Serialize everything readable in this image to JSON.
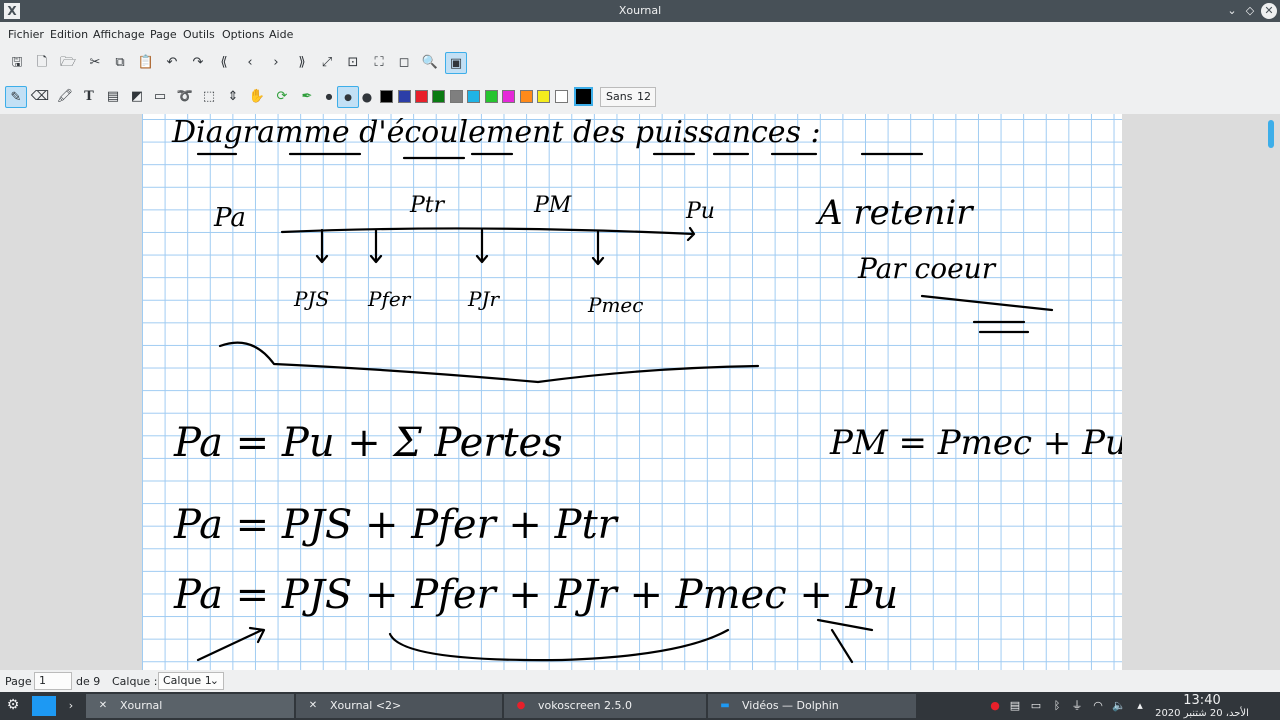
{
  "window": {
    "title": "Xournal",
    "app_icon": "X",
    "controls": {
      "minimize": "⌄",
      "maximize": "◇",
      "close": "✕"
    }
  },
  "menu": [
    "Fichier",
    "Edition",
    "Affichage",
    "Page",
    "Outils",
    "Options",
    "Aide"
  ],
  "toolbar_main": [
    "save-icon",
    "new-icon",
    "open-icon",
    "cut-icon",
    "copy-icon",
    "paste-icon",
    "undo-icon",
    "redo-icon",
    "first-page-icon",
    "prev-page-icon",
    "next-page-icon",
    "last-page-icon",
    "zoom-fit-icon",
    "zoom-page-icon",
    "zoom-full-icon",
    "search-icon",
    "fullscreen-icon"
  ],
  "toolbar_tools": {
    "tools": [
      "pen-icon",
      "eraser-icon",
      "highlighter-icon",
      "text-icon",
      "image-icon",
      "shape-icon",
      "ruler-icon",
      "lasso-icon",
      "rect-select-icon",
      "vspace-icon",
      "hand-icon",
      "default-tool-icon",
      "default-pen-icon"
    ],
    "colors": [
      "#000000",
      "#2c3ea8",
      "#e8202a",
      "#0a7a12",
      "#7f7f7f",
      "#1fb4e6",
      "#26c42f",
      "#e528d9",
      "#ff8a1a",
      "#f4ec1d",
      "#ffffff"
    ],
    "selected_color": "#000000",
    "font_name": "Sans",
    "font_size": "12"
  },
  "status": {
    "page_label": "Page",
    "page_value": "1",
    "page_total": "de 9",
    "layer_label": "Calque :",
    "layer_value": "Calque 1"
  },
  "note": {
    "heading": "Diagramme d'écoulement des puissances :",
    "flow_labels": [
      "Pa",
      "Ptr",
      "PM",
      "Pu"
    ],
    "loss_labels": [
      "PJS",
      "Pfer",
      "PJr",
      "Pmec"
    ],
    "aside": [
      "A retenir",
      "Par coeur"
    ],
    "equations": [
      "Pa = Pu + Σ Pertes",
      "PM = Pmec + Pu",
      "Pa = PJS + Pfer + Ptr",
      "Pa = PJS + Pfer + PJr + Pmec + Pu"
    ]
  },
  "taskbar": {
    "tasks": [
      "Xournal",
      "Xournal <2>",
      "vokoscreen 2.5.0",
      "Vidéos — Dolphin"
    ],
    "time": "13:40",
    "date": "الأحد، 20 شتنبر 2020"
  }
}
